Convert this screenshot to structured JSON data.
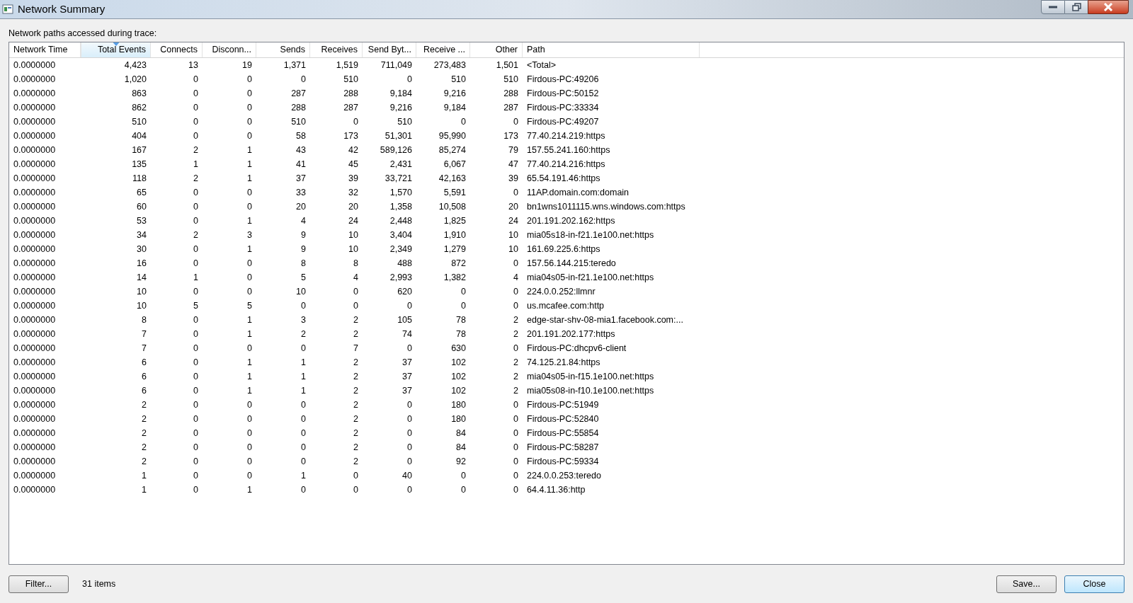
{
  "window": {
    "title": "Network Summary"
  },
  "caption": "Network paths accessed during trace:",
  "table": {
    "columns": [
      {
        "label": "Network Time",
        "kind": "text",
        "sorted": false
      },
      {
        "label": "Total Events",
        "kind": "number",
        "sorted": true
      },
      {
        "label": "Connects",
        "kind": "number",
        "sorted": false
      },
      {
        "label": "Disconn...",
        "kind": "number",
        "sorted": false
      },
      {
        "label": "Sends",
        "kind": "number",
        "sorted": false
      },
      {
        "label": "Receives",
        "kind": "number",
        "sorted": false
      },
      {
        "label": "Send Byt...",
        "kind": "number",
        "sorted": false
      },
      {
        "label": "Receive ...",
        "kind": "number",
        "sorted": false
      },
      {
        "label": "Other",
        "kind": "number",
        "sorted": false
      },
      {
        "label": "Path",
        "kind": "text",
        "sorted": false
      }
    ],
    "rows": [
      [
        "0.0000000",
        "4,423",
        "13",
        "19",
        "1,371",
        "1,519",
        "711,049",
        "273,483",
        "1,501",
        "<Total>"
      ],
      [
        "0.0000000",
        "1,020",
        "0",
        "0",
        "0",
        "510",
        "0",
        "510",
        "510",
        "Firdous-PC:49206"
      ],
      [
        "0.0000000",
        "863",
        "0",
        "0",
        "287",
        "288",
        "9,184",
        "9,216",
        "288",
        "Firdous-PC:50152"
      ],
      [
        "0.0000000",
        "862",
        "0",
        "0",
        "288",
        "287",
        "9,216",
        "9,184",
        "287",
        "Firdous-PC:33334"
      ],
      [
        "0.0000000",
        "510",
        "0",
        "0",
        "510",
        "0",
        "510",
        "0",
        "0",
        "Firdous-PC:49207"
      ],
      [
        "0.0000000",
        "404",
        "0",
        "0",
        "58",
        "173",
        "51,301",
        "95,990",
        "173",
        "77.40.214.219:https"
      ],
      [
        "0.0000000",
        "167",
        "2",
        "1",
        "43",
        "42",
        "589,126",
        "85,274",
        "79",
        "157.55.241.160:https"
      ],
      [
        "0.0000000",
        "135",
        "1",
        "1",
        "41",
        "45",
        "2,431",
        "6,067",
        "47",
        "77.40.214.216:https"
      ],
      [
        "0.0000000",
        "118",
        "2",
        "1",
        "37",
        "39",
        "33,721",
        "42,163",
        "39",
        "65.54.191.46:https"
      ],
      [
        "0.0000000",
        "65",
        "0",
        "0",
        "33",
        "32",
        "1,570",
        "5,591",
        "0",
        "11AP.domain.com:domain"
      ],
      [
        "0.0000000",
        "60",
        "0",
        "0",
        "20",
        "20",
        "1,358",
        "10,508",
        "20",
        "bn1wns1011115.wns.windows.com:https"
      ],
      [
        "0.0000000",
        "53",
        "0",
        "1",
        "4",
        "24",
        "2,448",
        "1,825",
        "24",
        "201.191.202.162:https"
      ],
      [
        "0.0000000",
        "34",
        "2",
        "3",
        "9",
        "10",
        "3,404",
        "1,910",
        "10",
        "mia05s18-in-f21.1e100.net:https"
      ],
      [
        "0.0000000",
        "30",
        "0",
        "1",
        "9",
        "10",
        "2,349",
        "1,279",
        "10",
        "161.69.225.6:https"
      ],
      [
        "0.0000000",
        "16",
        "0",
        "0",
        "8",
        "8",
        "488",
        "872",
        "0",
        "157.56.144.215:teredo"
      ],
      [
        "0.0000000",
        "14",
        "1",
        "0",
        "5",
        "4",
        "2,993",
        "1,382",
        "4",
        "mia04s05-in-f21.1e100.net:https"
      ],
      [
        "0.0000000",
        "10",
        "0",
        "0",
        "10",
        "0",
        "620",
        "0",
        "0",
        "224.0.0.252:llmnr"
      ],
      [
        "0.0000000",
        "10",
        "5",
        "5",
        "0",
        "0",
        "0",
        "0",
        "0",
        "us.mcafee.com:http"
      ],
      [
        "0.0000000",
        "8",
        "0",
        "1",
        "3",
        "2",
        "105",
        "78",
        "2",
        "edge-star-shv-08-mia1.facebook.com:..."
      ],
      [
        "0.0000000",
        "7",
        "0",
        "1",
        "2",
        "2",
        "74",
        "78",
        "2",
        "201.191.202.177:https"
      ],
      [
        "0.0000000",
        "7",
        "0",
        "0",
        "0",
        "7",
        "0",
        "630",
        "0",
        "Firdous-PC:dhcpv6-client"
      ],
      [
        "0.0000000",
        "6",
        "0",
        "1",
        "1",
        "2",
        "37",
        "102",
        "2",
        "74.125.21.84:https"
      ],
      [
        "0.0000000",
        "6",
        "0",
        "1",
        "1",
        "2",
        "37",
        "102",
        "2",
        "mia04s05-in-f15.1e100.net:https"
      ],
      [
        "0.0000000",
        "6",
        "0",
        "1",
        "1",
        "2",
        "37",
        "102",
        "2",
        "mia05s08-in-f10.1e100.net:https"
      ],
      [
        "0.0000000",
        "2",
        "0",
        "0",
        "0",
        "2",
        "0",
        "180",
        "0",
        "Firdous-PC:51949"
      ],
      [
        "0.0000000",
        "2",
        "0",
        "0",
        "0",
        "2",
        "0",
        "180",
        "0",
        "Firdous-PC:52840"
      ],
      [
        "0.0000000",
        "2",
        "0",
        "0",
        "0",
        "2",
        "0",
        "84",
        "0",
        "Firdous-PC:55854"
      ],
      [
        "0.0000000",
        "2",
        "0",
        "0",
        "0",
        "2",
        "0",
        "84",
        "0",
        "Firdous-PC:58287"
      ],
      [
        "0.0000000",
        "2",
        "0",
        "0",
        "0",
        "2",
        "0",
        "92",
        "0",
        "Firdous-PC:59334"
      ],
      [
        "0.0000000",
        "1",
        "0",
        "0",
        "1",
        "0",
        "40",
        "0",
        "0",
        "224.0.0.253:teredo"
      ],
      [
        "0.0000000",
        "1",
        "0",
        "1",
        "0",
        "0",
        "0",
        "0",
        "0",
        "64.4.11.36:http"
      ]
    ]
  },
  "footer": {
    "filter_button": "Filter...",
    "count": "31 items",
    "save_button": "Save...",
    "close_button": "Close"
  }
}
